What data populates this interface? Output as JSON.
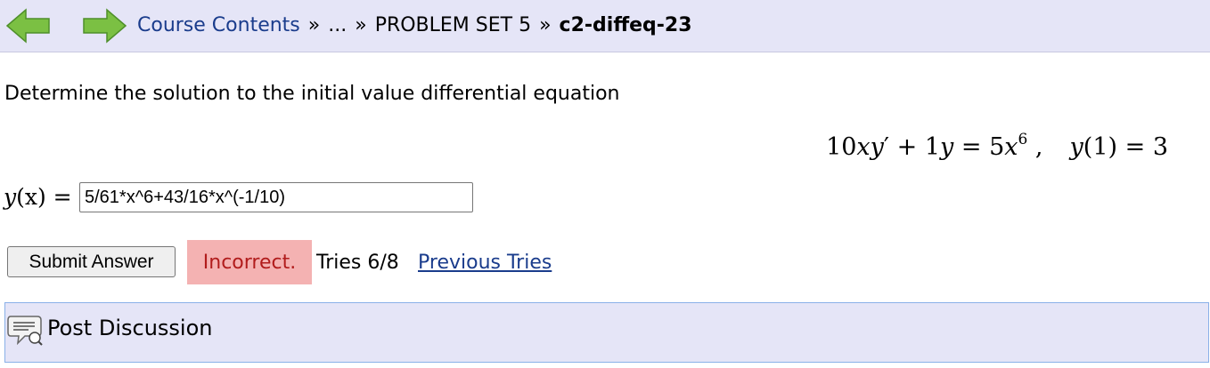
{
  "nav": {
    "back_icon": "back-arrow-icon",
    "forward_icon": "forward-arrow-icon",
    "arrow_color": "#7bc043"
  },
  "breadcrumb": {
    "items": [
      "Course Contents",
      "...",
      "PROBLEM SET 5"
    ],
    "separator": "»",
    "current": "c2-diffeq-23"
  },
  "problem": {
    "prompt": "Determine the solution to the initial value differential equation",
    "equation": {
      "coef1": "10",
      "var_xy": "xy",
      "prime": "′",
      "plus": " + ",
      "coef2": "1",
      "var_y": "y",
      "equals": " = ",
      "coef3": "5",
      "var_x": "x",
      "exponent": "6",
      "comma": " ,",
      "ic_lhs": "y",
      "ic_arg": "(1)",
      "ic_rhs": " = 3"
    }
  },
  "answer": {
    "label_var": "y",
    "label_arg": "(x)",
    "label_eq": " = ",
    "value": "5/61*x^6+43/16*x^(-1/10)"
  },
  "submission": {
    "submit_label": "Submit Answer",
    "status": "Incorrect.",
    "status_bg": "#f4b2b2",
    "status_color": "#b11c1c",
    "tries": "Tries 6/8",
    "previous_tries_label": "Previous Tries"
  },
  "discussion": {
    "icon": "speech-bubble-icon",
    "label": "Post Discussion"
  }
}
